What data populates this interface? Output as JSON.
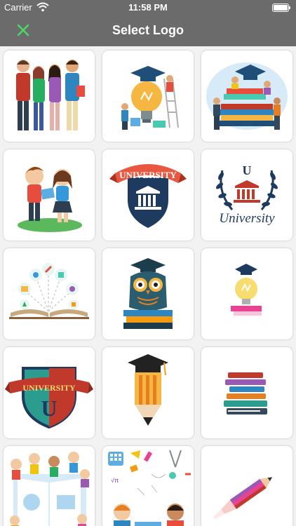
{
  "status_bar": {
    "carrier": "Carrier",
    "time": "11:58 PM"
  },
  "navbar": {
    "title": "Select Logo",
    "close_color": "#4cd964"
  },
  "logos": [
    {
      "icon": "students-group"
    },
    {
      "icon": "graduation-lightbulb"
    },
    {
      "icon": "students-books-cap"
    },
    {
      "icon": "children-reading"
    },
    {
      "icon": "university-shield",
      "label": "UNIVERSITY"
    },
    {
      "icon": "university-laurel",
      "letter": "U",
      "label": "University"
    },
    {
      "icon": "open-book-ideas"
    },
    {
      "icon": "owl-on-books"
    },
    {
      "icon": "lightbulb-cap-books"
    },
    {
      "icon": "university-crest",
      "letter": "U",
      "label": "UNIVERSITY"
    },
    {
      "icon": "pencil-cap"
    },
    {
      "icon": "stacked-books"
    },
    {
      "icon": "children-drawing-book"
    },
    {
      "icon": "school-supplies-pattern"
    },
    {
      "icon": "flying-pencil"
    }
  ]
}
